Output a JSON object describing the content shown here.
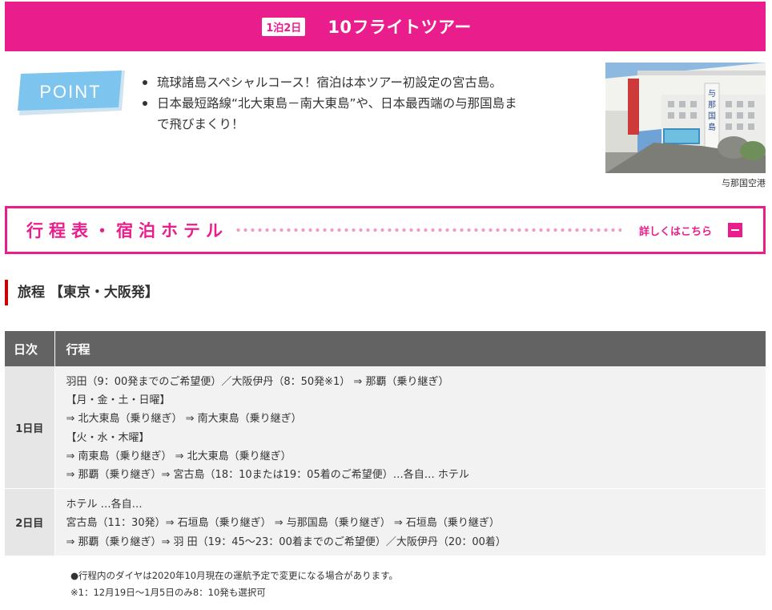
{
  "header": {
    "badge": "1泊2日",
    "title": "10フライトツアー"
  },
  "point": {
    "logo_text": "POINT",
    "bullets": [
      "琉球諸島スペシャルコース！宿泊は本ツアー初設定の宮古島。",
      "日本最短路線“北大東島－南大東島”や、日本最西端の与那国島ま",
      "で飛びまくり！"
    ]
  },
  "photo": {
    "sign_text": "与那国島",
    "caption": "与那国空港"
  },
  "toggle": {
    "title": "行程表・宿泊ホテル",
    "detail_link": "詳しくはこちら"
  },
  "section": {
    "heading": "旅程 【東京・大阪発】"
  },
  "table": {
    "headers": [
      "日次",
      "行程"
    ],
    "rows": [
      {
        "day": "1日目",
        "lines": [
          "羽田（9：00発までのご希望便）／大阪伊丹（8：50発※1） ⇒ 那覇（乗り継ぎ）",
          "【月・金・土・日曜】",
          "⇒ 北大東島（乗り継ぎ） ⇒ 南大東島（乗り継ぎ）",
          "【火・水・木曜】",
          "⇒ 南東島（乗り継ぎ） ⇒ 北大東島（乗り継ぎ）",
          "⇒ 那覇（乗り継ぎ）⇒ 宮古島（18：10または19：05着のご希望便）…各自… ホテル"
        ]
      },
      {
        "day": "2日目",
        "lines": [
          "ホテル …各自…",
          "宮古島（11：30発）⇒ 石垣島（乗り継ぎ） ⇒ 与那国島（乗り継ぎ） ⇒ 石垣島（乗り継ぎ）",
          "⇒ 那覇（乗り継ぎ）⇒ 羽 田（19：45～23：00着までのご希望便）／大阪伊丹（20：00着）"
        ]
      }
    ]
  },
  "notes": [
    "●行程内のダイヤは2020年10月現在の運航予定で変更になる場合があります。",
    "※1：12月19日～1月5日のみ8：10発も選択可"
  ],
  "colors": {
    "brand_pink": "#e91e8c",
    "table_header": "#636363",
    "heading_accent": "#cc0000"
  }
}
